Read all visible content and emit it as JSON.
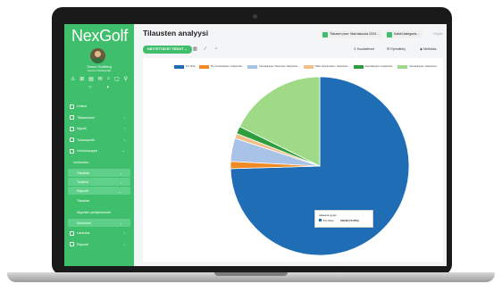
{
  "app": {
    "brand": "NexGolf"
  },
  "user": {
    "name": "Simon Golfberg",
    "role": "Seuran Pääkäyttäjä"
  },
  "sidebar": {
    "items": [
      {
        "label": "Uutiset"
      },
      {
        "label": "Tiliasetukset"
      },
      {
        "label": "Myynti"
      },
      {
        "label": "Tulosraportit"
      },
      {
        "label": "Verkkokauppa"
      },
      {
        "label": "Verkkosivu"
      },
      {
        "label": "Tilaukset"
      },
      {
        "label": "Tuotteet"
      },
      {
        "label": "Raportit"
      },
      {
        "label": "Tilaukset"
      },
      {
        "label": "Myyntien yksityiskohdat"
      },
      {
        "label": "Asetukset"
      },
      {
        "label": "Laskutus"
      },
      {
        "label": "Raportit"
      }
    ]
  },
  "header": {
    "title": "Tilausten analyysi",
    "chip_period": "Tilausen pvm: Marraskuuta 2024 ...",
    "chip_category": "Kaikki kategoria ...",
    "chip_more": "Näyttä..."
  },
  "toolbar": {
    "saved_tests": "NÄYTETTÄVÄT TIEDOT",
    "filters": "Suodattimet",
    "layout": "Ryhmittely",
    "metrics": "Metriikka"
  },
  "chart_data": {
    "type": "pie",
    "title": "",
    "legend_position": "top",
    "series": [
      {
        "name": "Pro Shop",
        "value": 318.36,
        "percent": 74.55,
        "color": "#1f6eb5"
      },
      {
        "name": "Pro Kovaharjoitus / Harjoitusto...",
        "value": 5.5,
        "percent": 1.29,
        "color": "#f08a24"
      },
      {
        "name": "Sauvakauppa / Ravintola / Harjoitusto...",
        "value": 18.0,
        "percent": 4.22,
        "color": "#a9c3e8"
      },
      {
        "name": "Pikku Harjoitusalue / Harjoitusto...",
        "value": 3.8,
        "percent": 0.89,
        "color": "#f4be87"
      },
      {
        "name": "Sauvakauppa / Harjoitusto...",
        "value": 5.8,
        "percent": 1.36,
        "color": "#2e9d3e"
      },
      {
        "name": "Sauvakauppa / Harjoitusto...",
        "value": 75.6,
        "percent": 17.69,
        "color": "#9fdb86"
      }
    ]
  },
  "tooltip": {
    "heading": "Jakauma tyyppi",
    "series": "Pro Shop",
    "value": "318,36 (74.55%)"
  }
}
